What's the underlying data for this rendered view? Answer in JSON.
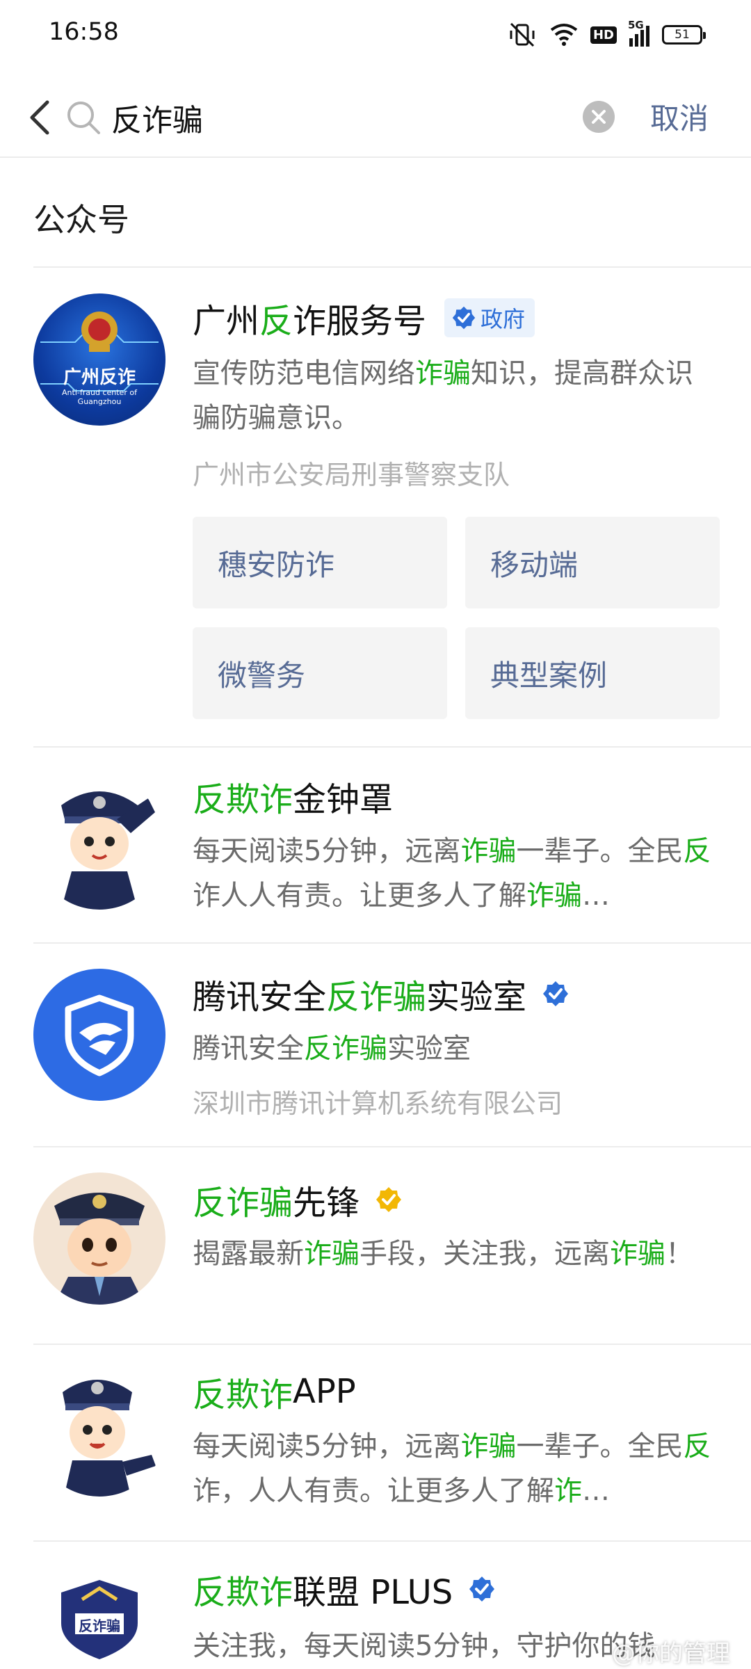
{
  "status_bar": {
    "time": "16:58",
    "hd": "HD",
    "network": "5G",
    "battery": "51"
  },
  "search": {
    "value": "反诈骗",
    "cancel_label": "取消"
  },
  "section_title": "公众号",
  "results": [
    {
      "title_parts": [
        {
          "t": "广州",
          "hl": false
        },
        {
          "t": "反",
          "hl": true
        },
        {
          "t": "诈服务号",
          "hl": false
        }
      ],
      "badge": "政府",
      "desc_parts": [
        {
          "t": "宣传防范电信网络",
          "hl": false
        },
        {
          "t": "诈骗",
          "hl": true
        },
        {
          "t": "知识，提高群众识骗防骗意识。",
          "hl": false
        }
      ],
      "subtitle": "广州市公安局刑事警察支队",
      "avatar_text": "广州反诈",
      "avatar_subtext": "Anti-fraud center of Guangzhou",
      "menu": [
        "穗安防诈",
        "移动端",
        "微警务",
        "典型案例"
      ]
    },
    {
      "title_parts": [
        {
          "t": "反欺诈",
          "hl": true
        },
        {
          "t": "金钟罩",
          "hl": false
        }
      ],
      "desc_parts": [
        {
          "t": "每天阅读5分钟，远离",
          "hl": false
        },
        {
          "t": "诈骗",
          "hl": true
        },
        {
          "t": "一辈子。全民",
          "hl": false
        },
        {
          "t": "反",
          "hl": true
        },
        {
          "t": "诈人人有责。让更多人了解",
          "hl": false
        },
        {
          "t": "诈骗",
          "hl": true
        },
        {
          "t": "…",
          "hl": false
        }
      ]
    },
    {
      "title_parts": [
        {
          "t": "腾讯安全",
          "hl": false
        },
        {
          "t": "反诈骗",
          "hl": true
        },
        {
          "t": "实验室",
          "hl": false
        }
      ],
      "desc_parts": [
        {
          "t": "腾讯安全",
          "hl": false
        },
        {
          "t": "反诈骗",
          "hl": true
        },
        {
          "t": "实验室",
          "hl": false
        }
      ],
      "subtitle": "深圳市腾讯计算机系统有限公司"
    },
    {
      "title_parts": [
        {
          "t": "反诈骗",
          "hl": true
        },
        {
          "t": "先锋",
          "hl": false
        }
      ],
      "desc_parts": [
        {
          "t": "揭露最新",
          "hl": false
        },
        {
          "t": "诈骗",
          "hl": true
        },
        {
          "t": "手段，关注我，远离",
          "hl": false
        },
        {
          "t": "诈骗",
          "hl": true
        },
        {
          "t": "！",
          "hl": false
        }
      ]
    },
    {
      "title_parts": [
        {
          "t": "反欺诈",
          "hl": true
        },
        {
          "t": "APP",
          "hl": false
        }
      ],
      "desc_parts": [
        {
          "t": "每天阅读5分钟，远离",
          "hl": false
        },
        {
          "t": "诈骗",
          "hl": true
        },
        {
          "t": "一辈子。全民",
          "hl": false
        },
        {
          "t": "反",
          "hl": true
        },
        {
          "t": "诈，人人有责。让更多人了解",
          "hl": false
        },
        {
          "t": "诈",
          "hl": true
        },
        {
          "t": "…",
          "hl": false
        }
      ]
    },
    {
      "title_parts": [
        {
          "t": "反欺诈",
          "hl": true
        },
        {
          "t": "联盟 PLUS",
          "hl": false
        }
      ],
      "desc_parts": [
        {
          "t": "关注我，每天阅读5分钟，守护你的钱",
          "hl": false
        }
      ],
      "avatar_text": "反诈骗"
    }
  ],
  "watermark": "@你的管理"
}
